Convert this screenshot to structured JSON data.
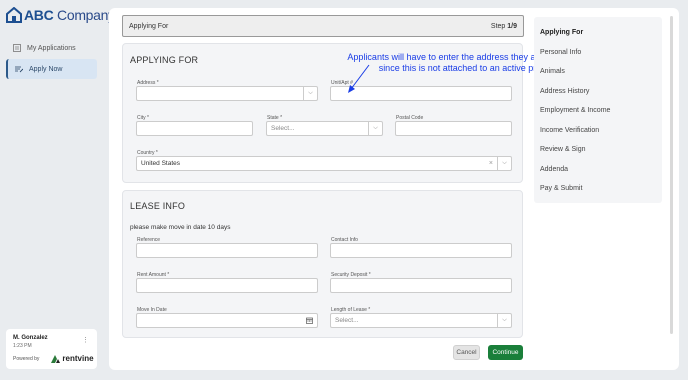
{
  "brand": {
    "name_prefix": "ABC",
    "name_suffix": " Company"
  },
  "sidebar": {
    "items": [
      {
        "label": "My Applications",
        "icon": "list-icon",
        "active": false
      },
      {
        "label": "Apply Now",
        "icon": "form-icon",
        "active": true
      }
    ]
  },
  "user": {
    "name": "M. Gonzalez",
    "time": "1:23 PM",
    "powered_by": "Powered by",
    "vendor": "rentvine"
  },
  "step_bar": {
    "title": "Applying For",
    "step_prefix": "Step ",
    "step_value": "1/9"
  },
  "annotation": "Applicants will have to enter the address they are applying for since this is not attached to an active property",
  "applying_for": {
    "title": "APPLYING FOR",
    "address_label": "Address *",
    "unit_label": "Unit/Apt #",
    "city_label": "City *",
    "state_label": "State *",
    "state_placeholder": "Select...",
    "postal_label": "Postal Code",
    "country_label": "Country *",
    "country_value": "United States"
  },
  "lease_info": {
    "title": "LEASE INFO",
    "note": "please make move in date 10 days",
    "reference_label": "Reference",
    "contact_label": "Contact Info",
    "rent_label": "Rent Amount *",
    "deposit_label": "Security Deposit *",
    "movein_label": "Move In Date",
    "length_label": "Length of Lease *",
    "length_placeholder": "Select..."
  },
  "steps": [
    {
      "label": "Applying For",
      "current": true
    },
    {
      "label": "Personal Info",
      "current": false
    },
    {
      "label": "Animals",
      "current": false
    },
    {
      "label": "Address History",
      "current": false
    },
    {
      "label": "Employment & Income",
      "current": false
    },
    {
      "label": "Income Verification",
      "current": false
    },
    {
      "label": "Review & Sign",
      "current": false
    },
    {
      "label": "Addenda",
      "current": false
    },
    {
      "label": "Pay & Submit",
      "current": false
    }
  ],
  "buttons": {
    "cancel": "Cancel",
    "continue": "Continue"
  },
  "colors": {
    "brand": "#1d4f91",
    "annotation": "#1a3de6",
    "continue": "#1a7f3a",
    "nav_active": "#d8e5f3"
  }
}
